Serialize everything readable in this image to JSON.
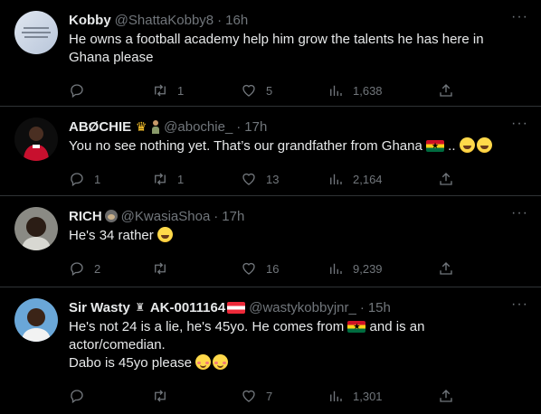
{
  "more_label": "···",
  "tweets": [
    {
      "name": "Kobby",
      "handle": "@ShattaKobby8",
      "time": "16h",
      "text": "He owns a football academy help him grow the talents he has here in Ghana please",
      "replies": "",
      "retweets": "1",
      "likes": "5",
      "views": "1,638"
    },
    {
      "name": "ABØCHIE",
      "handle": "@abochie_",
      "time": "17h",
      "text_before_flag": "You no see nothing yet. That’s our grandfather from Ghana ",
      "text_after_flag": " .. ",
      "replies": "1",
      "retweets": "1",
      "likes": "13",
      "views": "2,164"
    },
    {
      "name": "RICH",
      "handle": "@KwasiaShoa",
      "time": "17h",
      "text": "He's 34 rather ",
      "replies": "2",
      "retweets": "",
      "likes": "16",
      "views": "9,239"
    },
    {
      "name": "Sir Wasty",
      "name_suffix": "AK-0011164",
      "handle": "@wastykobbyjnr_",
      "time": "15h",
      "line1_before_flag": "He's not 24 is a lie, he's 45yo. He comes from ",
      "line1_after_flag": " and is an",
      "line2": "actor/comedian.",
      "line3": "Dabo is 45yo please ",
      "replies": "",
      "retweets": "",
      "likes": "7",
      "views": "1,301"
    }
  ],
  "colors": {
    "background": "#000000",
    "text": "#e7e9ea",
    "muted": "#71767b",
    "divider": "#2f3336"
  },
  "icons": [
    "reply-icon",
    "retweet-icon",
    "like-icon",
    "views-icon",
    "share-icon",
    "more-icon"
  ]
}
